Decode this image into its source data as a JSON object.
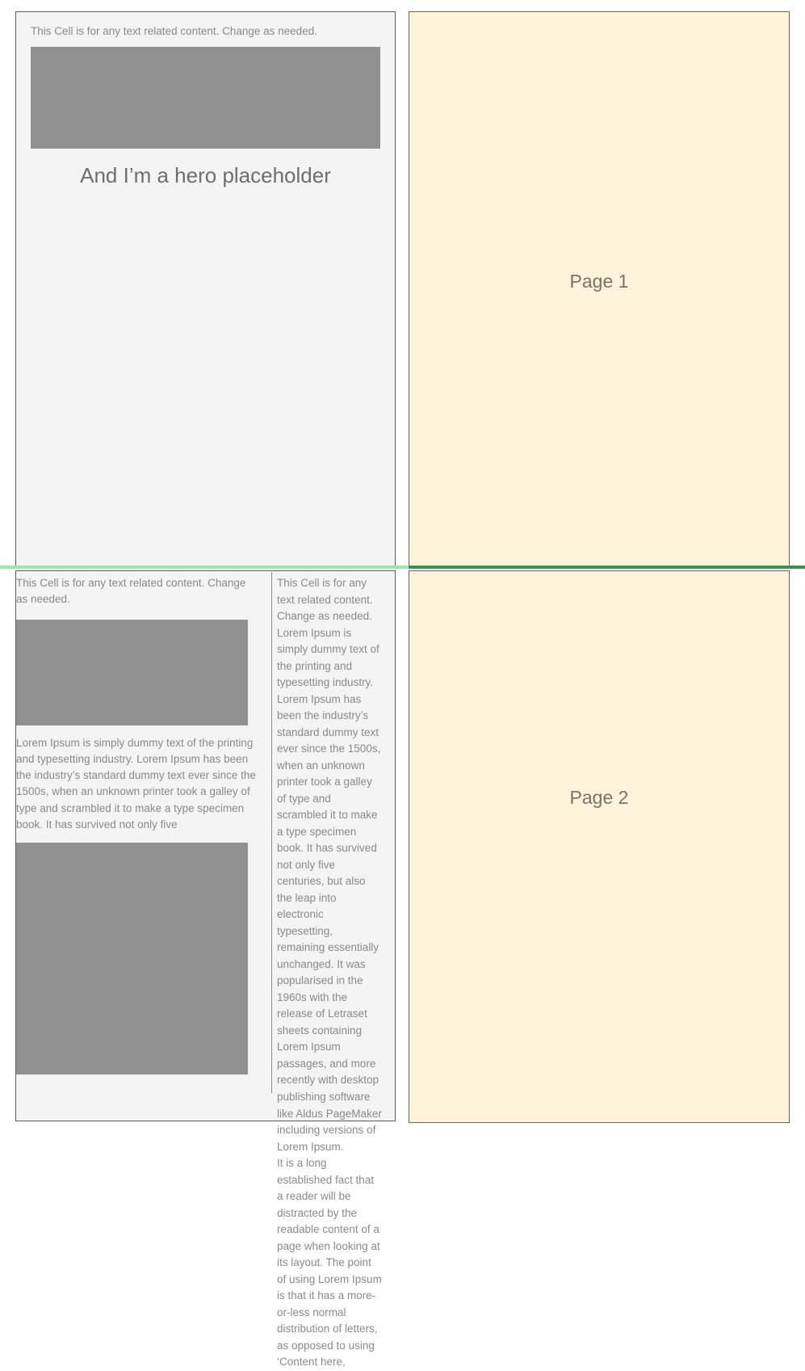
{
  "colors": {
    "panel_background": "#f4f4f4",
    "panel_border": "#5d5d5d",
    "page_background": "#fdf2da",
    "page_border": "#6b6355",
    "placeholder_image": "#909090",
    "body_text": "#8a8a8a",
    "caption_text": "#6e6e6e",
    "page_label_text": "#7b7366",
    "divider_light_green": "#9ee8a7",
    "divider_dark_green": "#3f8d52"
  },
  "row1": {
    "content_cell": {
      "note": "This Cell is for any text related content. Change as needed.",
      "hero_image_name": "hero-image-placeholder",
      "hero_caption": "And I’m a hero placeholder"
    },
    "page_cell": {
      "label": "Page 1"
    }
  },
  "row2": {
    "left_column": {
      "note": "This Cell is for any text related content. Change as needed.",
      "image_top_name": "image-placeholder-top",
      "body": "Lorem Ipsum is simply dummy text of the printing and typesetting industry. Lorem Ipsum has been the industry’s standard dummy text ever since the 1500s, when an unknown printer took a galley of type and scrambled it to make a type specimen book. It has survived not only five",
      "image_bottom_name": "image-placeholder-bottom"
    },
    "narrow_column": {
      "paragraph_1": "This Cell is for any text related content. Change as needed. Lorem Ipsum is simply dummy text of the printing and typesetting industry. Lorem Ipsum has been the industry’s standard dummy text ever since the 1500s, when an unknown printer took a galley of type and scrambled it to make a type specimen book. It has survived not only five centuries, but also the leap into electronic typesetting, remaining essentially unchanged. It was popularised in the 1960s with the release of Letraset sheets containing Lorem Ipsum passages, and more recently with desktop publishing software like Aldus PageMaker including versions of Lorem Ipsum.",
      "paragraph_2": "It is a long established fact that a reader will be distracted by the readable content of a page when looking at its layout. The point of using Lorem Ipsum is that it has a more-or-less normal distribution of letters, as opposed to using ‘Content here,"
    },
    "page_cell": {
      "label": "Page 2"
    }
  }
}
